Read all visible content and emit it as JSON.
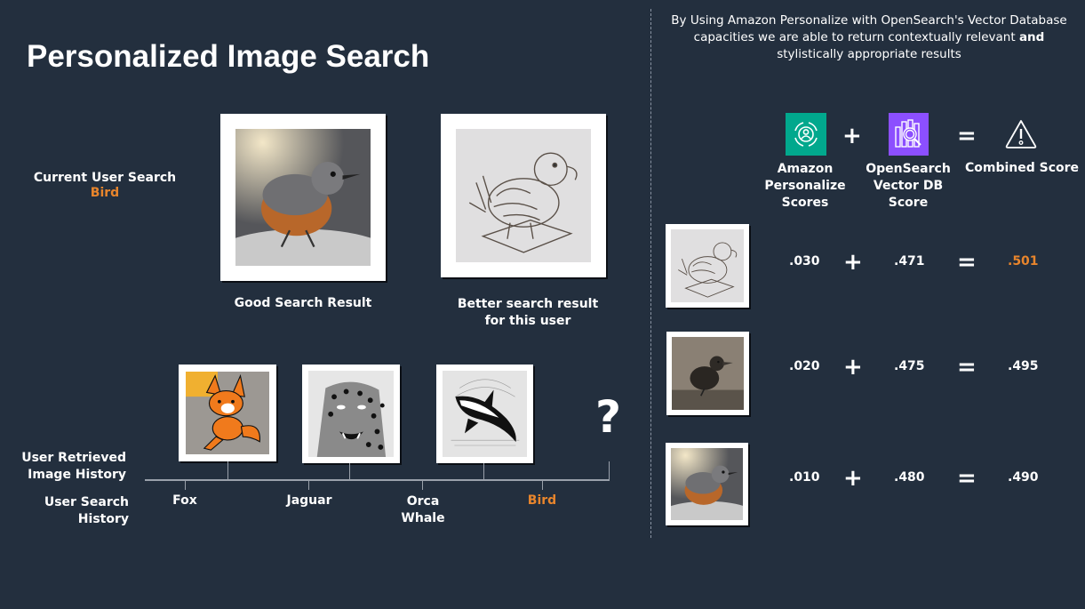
{
  "title": "Personalized Image Search",
  "current_search": {
    "label": "Current User Search",
    "query": "Bird"
  },
  "results": {
    "good": {
      "image": "realistic-bird-image",
      "caption": "Good Search Result"
    },
    "better": {
      "image": "sketch-bird-image",
      "caption_line1": "Better search result",
      "caption_line2": "for this user"
    }
  },
  "history": {
    "retrieved_label_line1": "User Retrieved",
    "retrieved_label_line2": "Image History",
    "search_label_line1": "User Search",
    "search_label_line2": "History",
    "images": [
      {
        "name": "fox-sketch-image"
      },
      {
        "name": "jaguar-sketch-image"
      },
      {
        "name": "orca-sketch-image"
      }
    ],
    "unknown_marker": "?",
    "searches": [
      {
        "line1": "Fox",
        "line2": ""
      },
      {
        "line1": "Jaguar",
        "line2": ""
      },
      {
        "line1": "Orca",
        "line2": "Whale"
      },
      {
        "line1": "Bird",
        "line2": "",
        "highlight": true
      }
    ]
  },
  "intro": {
    "text_regular": "By Using Amazon Personalize with OpenSearch's Vector Database capacities we are able to return contextually relevant ",
    "text_bold": "and",
    "text_tail": " stylistically appropriate results"
  },
  "formula": {
    "personalize": {
      "icon": "amazon-personalize-icon",
      "line1": "Amazon",
      "line2": "Personalize",
      "line3": "Scores",
      "color": "#01a88d"
    },
    "opensearch": {
      "icon": "opensearch-icon",
      "line1": "OpenSearch",
      "line2": "Vector DB",
      "line3": "Score",
      "color": "#8c4fff"
    },
    "combined": {
      "icon": "warning-icon",
      "label": "Combined Score"
    },
    "plus": "+",
    "equals": "="
  },
  "score_rows": [
    {
      "image": "sketch-bird-thumb",
      "personalize": ".030",
      "vector": ".471",
      "combined": ".501",
      "highlight": true
    },
    {
      "image": "vintage-bird-thumb",
      "personalize": ".020",
      "vector": ".475",
      "combined": ".495",
      "highlight": false
    },
    {
      "image": "realistic-bird-thumb",
      "personalize": ".010",
      "vector": ".480",
      "combined": ".490",
      "highlight": false
    }
  ],
  "colors": {
    "background": "#232f3e",
    "accent_orange": "#e8852c",
    "personalize_green": "#01a88d",
    "opensearch_purple": "#8c4fff"
  }
}
